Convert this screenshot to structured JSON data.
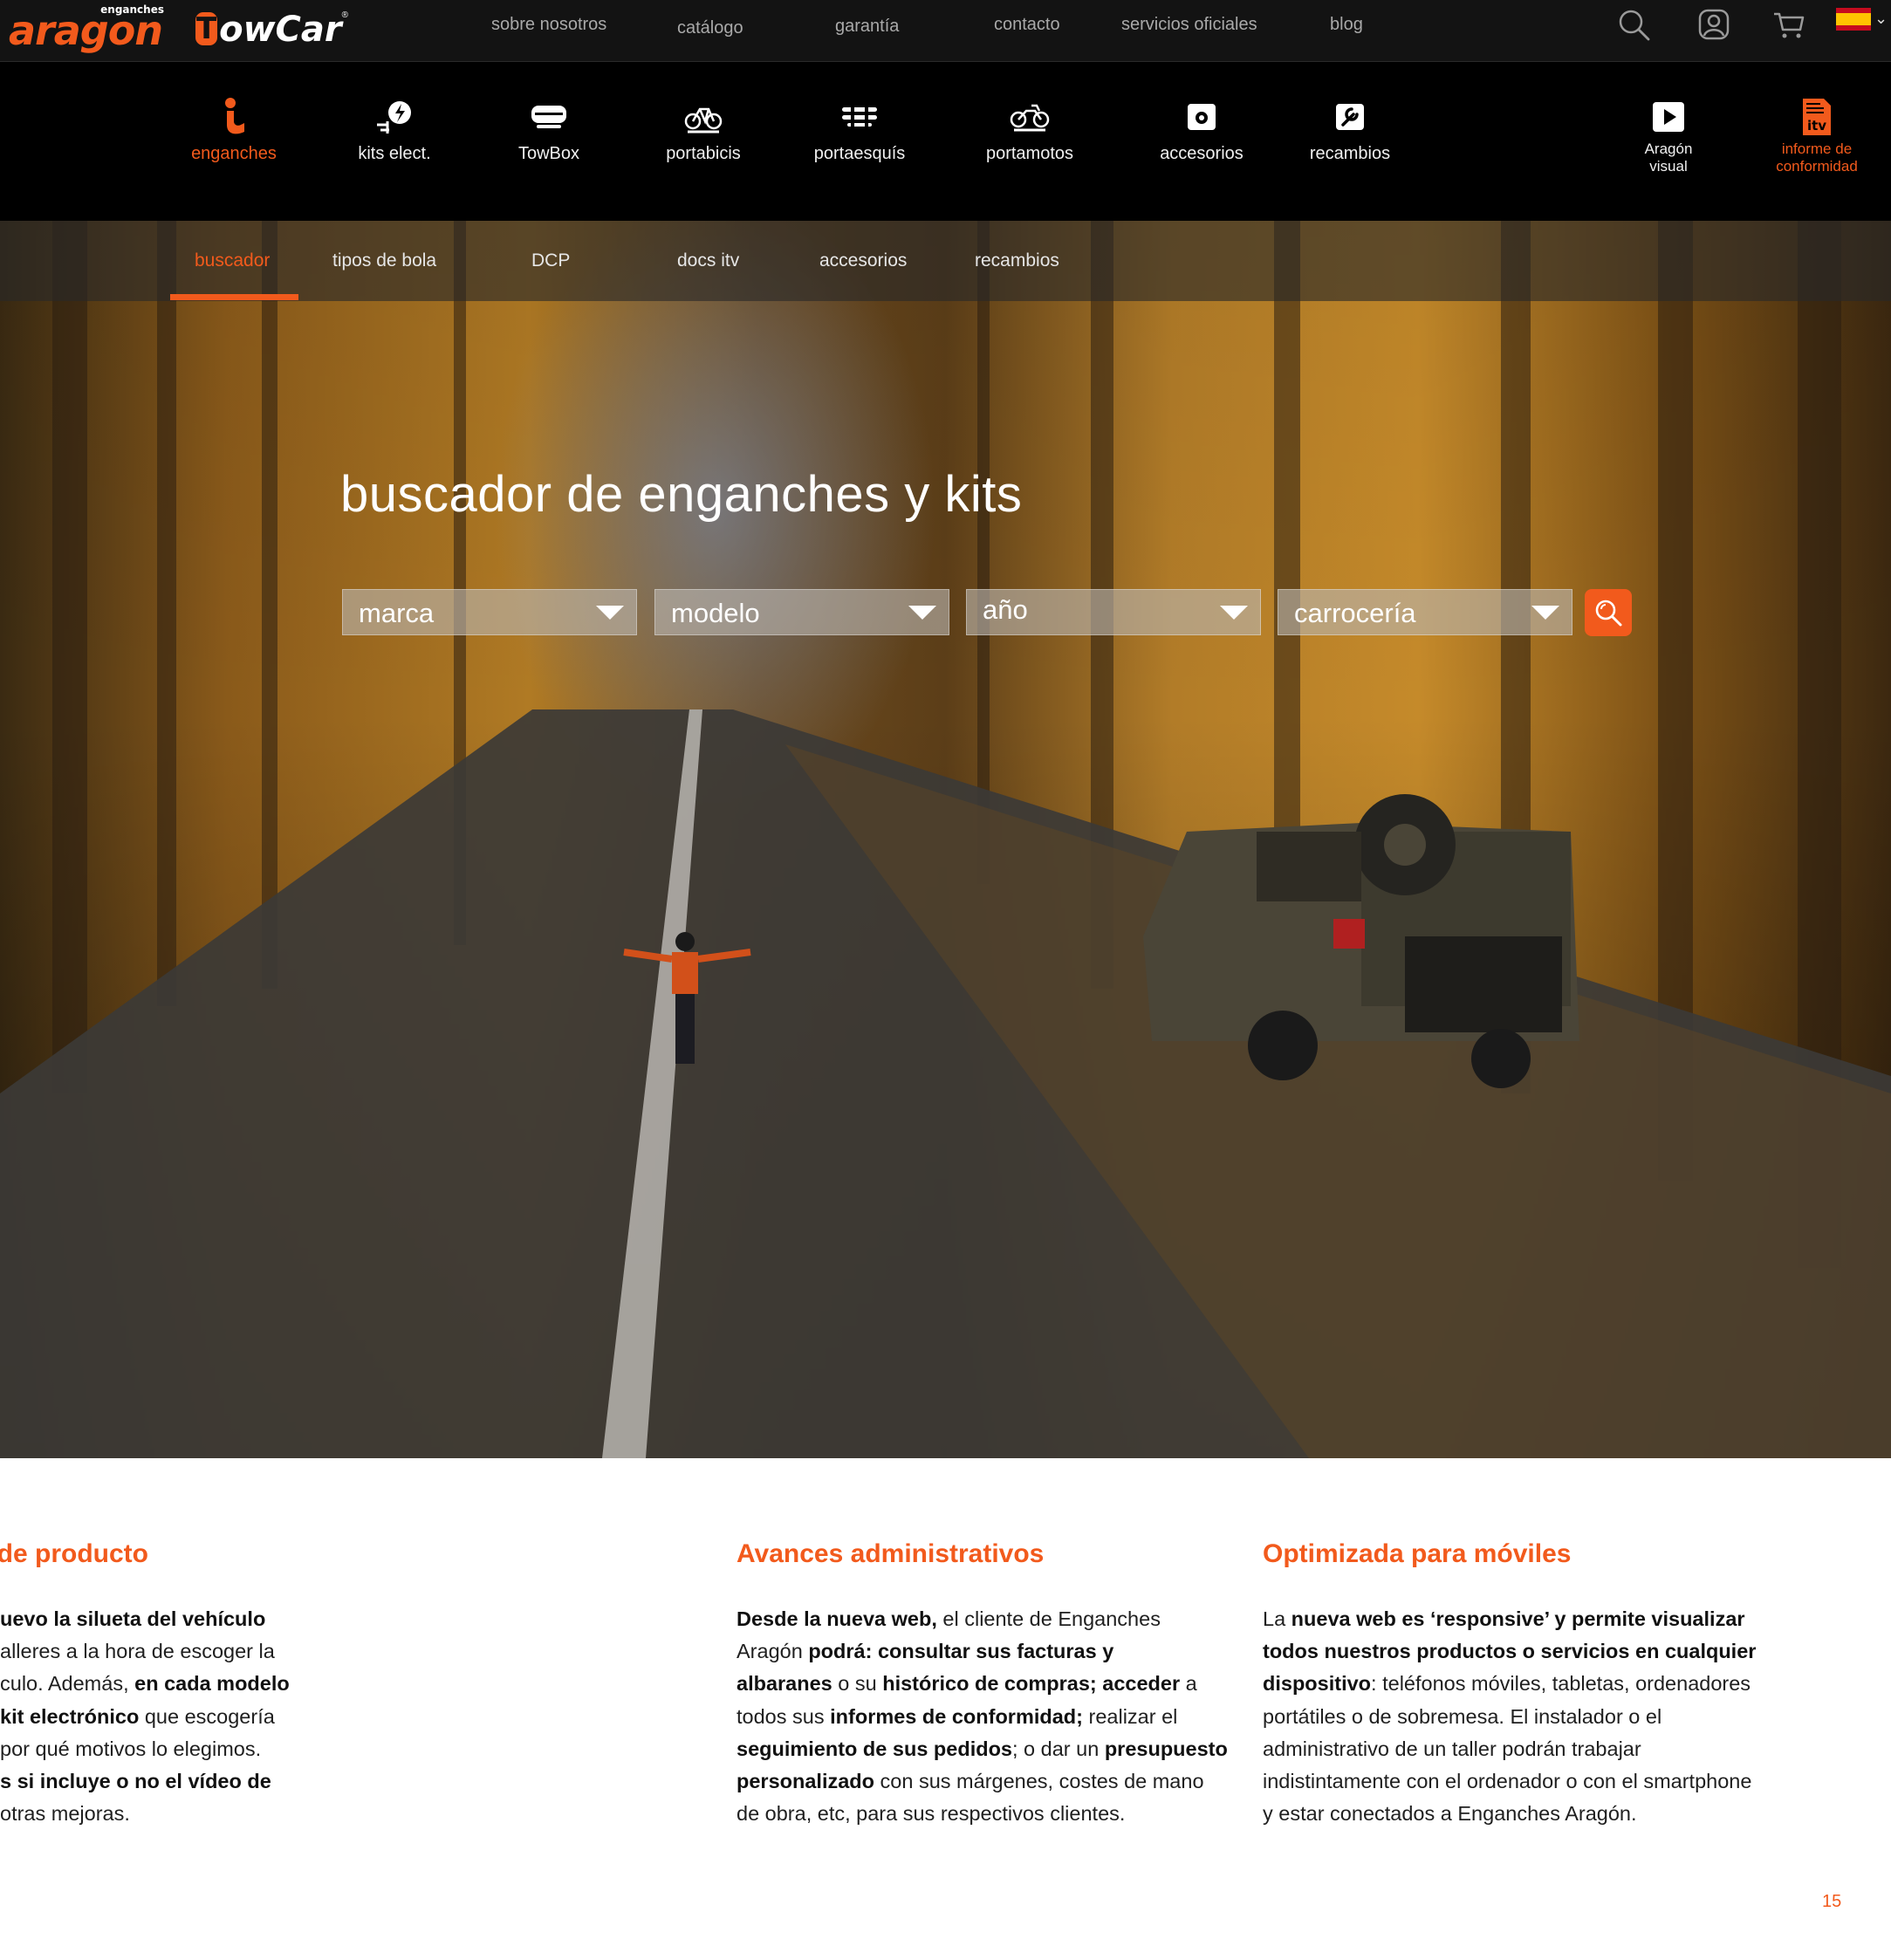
{
  "brand": {
    "aragon_small": "enganches",
    "aragon_word": "aragon",
    "towcar_letter": "T",
    "towcar_word": "owCar",
    "towcar_reg": "®"
  },
  "topnav": [
    "sobre nosotros",
    "catálogo",
    "garantía",
    "contacto",
    "servicios oficiales",
    "blog"
  ],
  "top_icons": [
    "search-icon",
    "user-icon",
    "cart-icon"
  ],
  "language": "es",
  "categories": [
    {
      "label": "enganches",
      "icon": "hitch-icon",
      "active": true
    },
    {
      "label": "kits elect.",
      "icon": "electric-plug-icon"
    },
    {
      "label": "TowBox",
      "icon": "towbox-icon"
    },
    {
      "label": "portabicis",
      "icon": "bike-icon"
    },
    {
      "label": "portaesquís",
      "icon": "ski-icon"
    },
    {
      "label": "portamotos",
      "icon": "motorbike-icon"
    },
    {
      "label": "accesorios",
      "icon": "accessory-icon"
    },
    {
      "label": "recambios",
      "icon": "wrench-icon"
    },
    {
      "label": "Aragón visual",
      "icon": "play-icon"
    },
    {
      "label": "informe de conformidad",
      "icon": "itv-document-icon"
    }
  ],
  "subnav": [
    "buscador",
    "tipos de bola",
    "DCP",
    "docs itv",
    "accesorios",
    "recambios"
  ],
  "hero": {
    "title": "buscador de enganches y kits",
    "selects": [
      "marca",
      "modelo",
      "año",
      "carrocería"
    ]
  },
  "columns": [
    {
      "title": "a de producto",
      "lines": [
        [
          {
            "t": "uevo la silueta del vehículo",
            "b": true
          }
        ],
        [
          {
            "t": "alleres a la hora de escoger la"
          }
        ],
        [
          {
            "t": "culo. Además, "
          },
          {
            "t": "en cada modelo",
            "b": true
          }
        ],
        [
          {
            "t": "kit electrónico",
            "b": true
          },
          {
            "t": " que escogería"
          }
        ],
        [
          {
            "t": " por qué motivos lo elegimos."
          }
        ],
        [
          {
            "t": "s si incluye o no el vídeo de",
            "b": true
          }
        ],
        [
          {
            "t": "otras mejoras."
          }
        ]
      ]
    },
    {
      "title": "Avances administrativos",
      "lines": [
        [
          {
            "t": "Desde la nueva web,",
            "b": true
          },
          {
            "t": " el cliente de Enganches"
          }
        ],
        [
          {
            "t": "Aragón "
          },
          {
            "t": "podrá: consultar sus facturas y",
            "b": true
          }
        ],
        [
          {
            "t": "albaranes",
            "b": true
          },
          {
            "t": " o su "
          },
          {
            "t": "histórico de compras; acceder",
            "b": true
          },
          {
            "t": " a"
          }
        ],
        [
          {
            "t": "todos sus "
          },
          {
            "t": "informes de conformidad;",
            "b": true
          },
          {
            "t": " realizar el"
          }
        ],
        [
          {
            "t": "seguimiento de sus pedidos",
            "b": true
          },
          {
            "t": "; o dar un "
          },
          {
            "t": "presupuesto",
            "b": true
          }
        ],
        [
          {
            "t": "personalizado",
            "b": true
          },
          {
            "t": " con sus márgenes, costes de mano"
          }
        ],
        [
          {
            "t": "de obra, etc, para sus respectivos clientes."
          }
        ]
      ]
    },
    {
      "title": "Optimizada para móviles",
      "lines": [
        [
          {
            "t": "La "
          },
          {
            "t": "nueva web es ‘responsive’ y permite visualizar",
            "b": true
          }
        ],
        [
          {
            "t": "todos nuestros productos o servicios en cualquier",
            "b": true
          }
        ],
        [
          {
            "t": "dispositivo",
            "b": true
          },
          {
            "t": ": teléfonos móviles, tabletas, ordenadores"
          }
        ],
        [
          {
            "t": "portátiles o de sobremesa. El instalador o el"
          }
        ],
        [
          {
            "t": "administrativo de un taller podrán trabajar"
          }
        ],
        [
          {
            "t": "indistintamente con el ordenador o con el smartphone"
          }
        ],
        [
          {
            "t": "y estar conectados a Enganches Aragón."
          }
        ]
      ]
    }
  ],
  "page_number": "15",
  "colors": {
    "accent": "#f25a1c",
    "bar": "#131313",
    "black": "#000000"
  }
}
